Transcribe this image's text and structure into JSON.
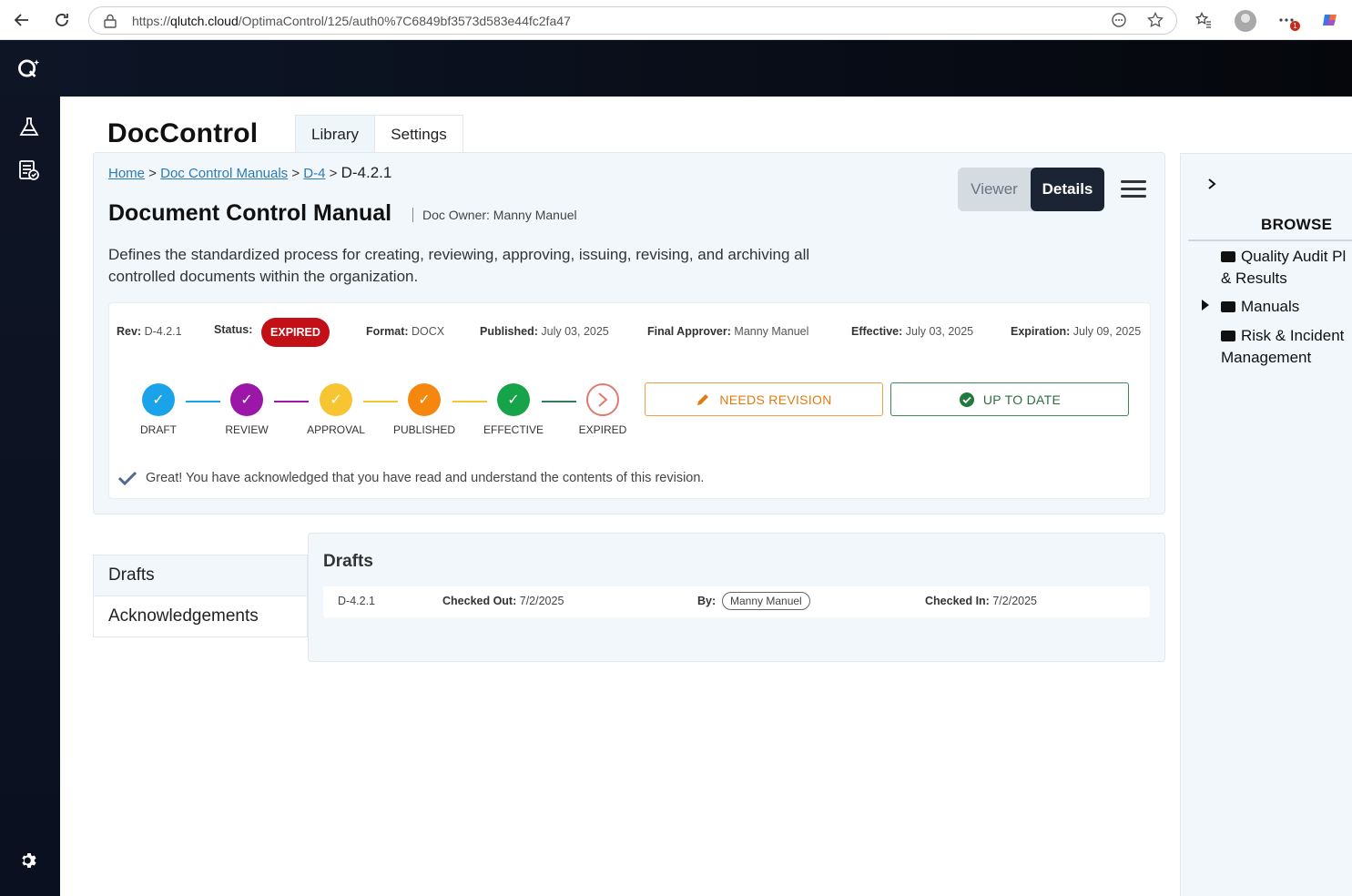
{
  "browser": {
    "url_domain": "qlutch.cloud",
    "url_path": "/OptimaControl/125/auth0%7C6849bf3573d583e44fc2fa47",
    "url_prefix": "https://"
  },
  "app": {
    "title": "DocControl",
    "tabs": [
      {
        "label": "Library"
      },
      {
        "label": "Settings"
      }
    ]
  },
  "breadcrumb": {
    "home": "Home",
    "manuals": "Doc Control Manuals",
    "section": "D-4",
    "current": "D-4.2.1"
  },
  "view_toggle": {
    "viewer": "Viewer",
    "details": "Details"
  },
  "document": {
    "title": "Document Control Manual",
    "owner": "Doc Owner: Manny Manuel",
    "description": "Defines the standardized process for creating, reviewing, approving, issuing, revising, and archiving all controlled documents within the organization."
  },
  "meta": {
    "rev_label": "Rev:",
    "rev": "D-4.2.1",
    "status_label": "Status:",
    "status": "EXPIRED",
    "format_label": "Format:",
    "format": "DOCX",
    "published_label": "Published:",
    "published": "July 03, 2025",
    "approver_label": "Final Approver:",
    "approver": "Manny Manuel",
    "effective_label": "Effective:",
    "effective": "July 03, 2025",
    "expiration_label": "Expiration:",
    "expiration": "July 09, 2025"
  },
  "stages": [
    {
      "label": "DRAFT",
      "color": "#1aa3e8"
    },
    {
      "label": "REVIEW",
      "color": "#9a17a8"
    },
    {
      "label": "APPROVAL",
      "color": "#f6c531"
    },
    {
      "label": "PUBLISHED",
      "color": "#f5870f"
    },
    {
      "label": "EFFECTIVE",
      "color": "#16a34a"
    },
    {
      "label": "EXPIRED",
      "color": "#e0796f"
    }
  ],
  "actions": {
    "needs_revision": "NEEDS REVISION",
    "up_to_date": "UP TO DATE"
  },
  "acknowledgement": "Great! You have acknowledged that you have read and understand the contents of this revision.",
  "lower_tabs": {
    "drafts": "Drafts",
    "acknowledgements": "Acknowledgements"
  },
  "drafts": {
    "title": "Drafts",
    "rows": [
      {
        "rev": "D-4.2.1",
        "checked_out_label": "Checked Out:",
        "checked_out": "7/2/2025",
        "by_label": "By:",
        "by": "Manny Manuel",
        "checked_in_label": "Checked In:",
        "checked_in": "7/2/2025"
      }
    ]
  },
  "browse": {
    "title": "BROWSE",
    "items": [
      {
        "line1": "Quality Audit Pl",
        "line2": "& Results"
      },
      {
        "line1": "Manuals"
      },
      {
        "line1": "Risk & Incident",
        "line2": "Management"
      }
    ]
  }
}
